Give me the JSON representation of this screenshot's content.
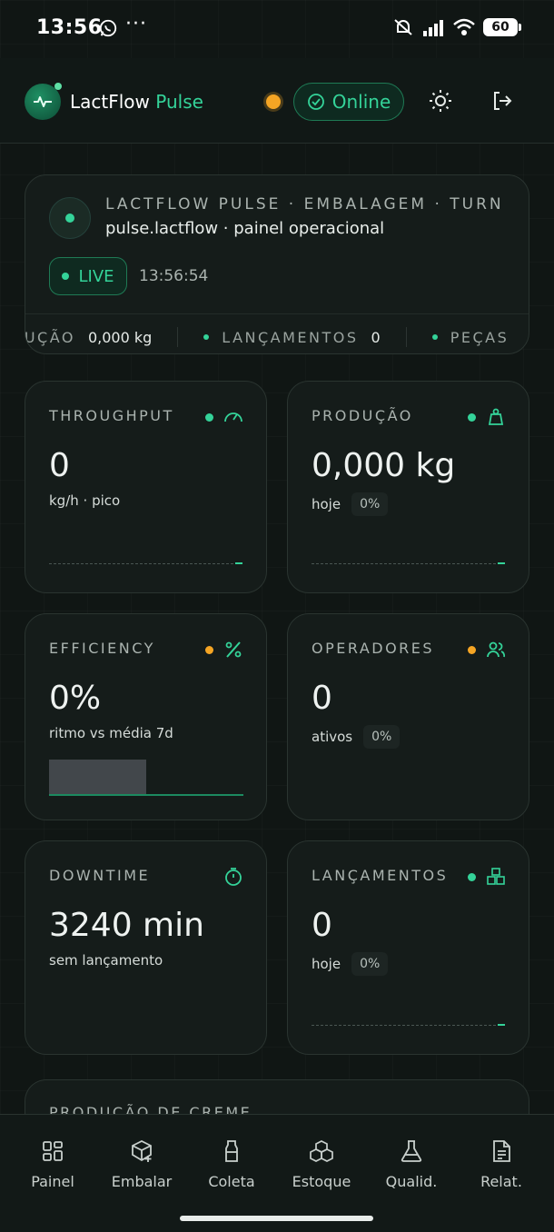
{
  "status_bar": {
    "time": "13:56",
    "dots": "···",
    "battery": "60"
  },
  "header": {
    "brand_main": "LactFlow",
    "brand_accent": "Pulse",
    "online_label": "Online"
  },
  "hero": {
    "kicker": "LACTFLOW PULSE · EMBALAGEM · TURN...",
    "subtitle": "pulse.lactflow · painel operacional",
    "live_label": "LIVE",
    "clock": "13:56:54",
    "ticker": [
      {
        "label": "DUÇÃO",
        "value": "0,000 kg"
      },
      {
        "label": "LANÇAMENTOS",
        "value": "0"
      },
      {
        "label": "PEÇAS",
        "value": ""
      }
    ]
  },
  "cards": {
    "throughput": {
      "label": "THROUGHPUT",
      "value": "0",
      "sub": "kg/h · pico"
    },
    "producao": {
      "label": "PRODUÇÃO",
      "value": "0,000 kg",
      "sub": "hoje",
      "chip": "0%"
    },
    "efficiency": {
      "label": "EFFICIENCY",
      "value": "0%",
      "sub": "ritmo vs média 7d",
      "level": 0.5
    },
    "operadores": {
      "label": "OPERADORES",
      "value": "0",
      "sub": "ativos",
      "chip": "0%"
    },
    "downtime": {
      "label": "DOWNTIME",
      "value": "3240 min",
      "sub": "sem lançamento"
    },
    "lancamentos": {
      "label": "LANÇAMENTOS",
      "value": "0",
      "sub": "hoje",
      "chip": "0%"
    }
  },
  "peek_card": {
    "label": "PRODUÇÃO DE CREME"
  },
  "nav": [
    {
      "label": "Painel",
      "icon": "grid-icon"
    },
    {
      "label": "Embalar",
      "icon": "package-plus-icon"
    },
    {
      "label": "Coleta",
      "icon": "milk-bottle-icon"
    },
    {
      "label": "Estoque",
      "icon": "boxes-icon"
    },
    {
      "label": "Qualid.",
      "icon": "flask-icon"
    },
    {
      "label": "Relat.",
      "icon": "report-icon"
    }
  ],
  "colors": {
    "accent": "#34d399",
    "warning": "#f5a524",
    "background": "#101614",
    "card": "#151c1a"
  }
}
